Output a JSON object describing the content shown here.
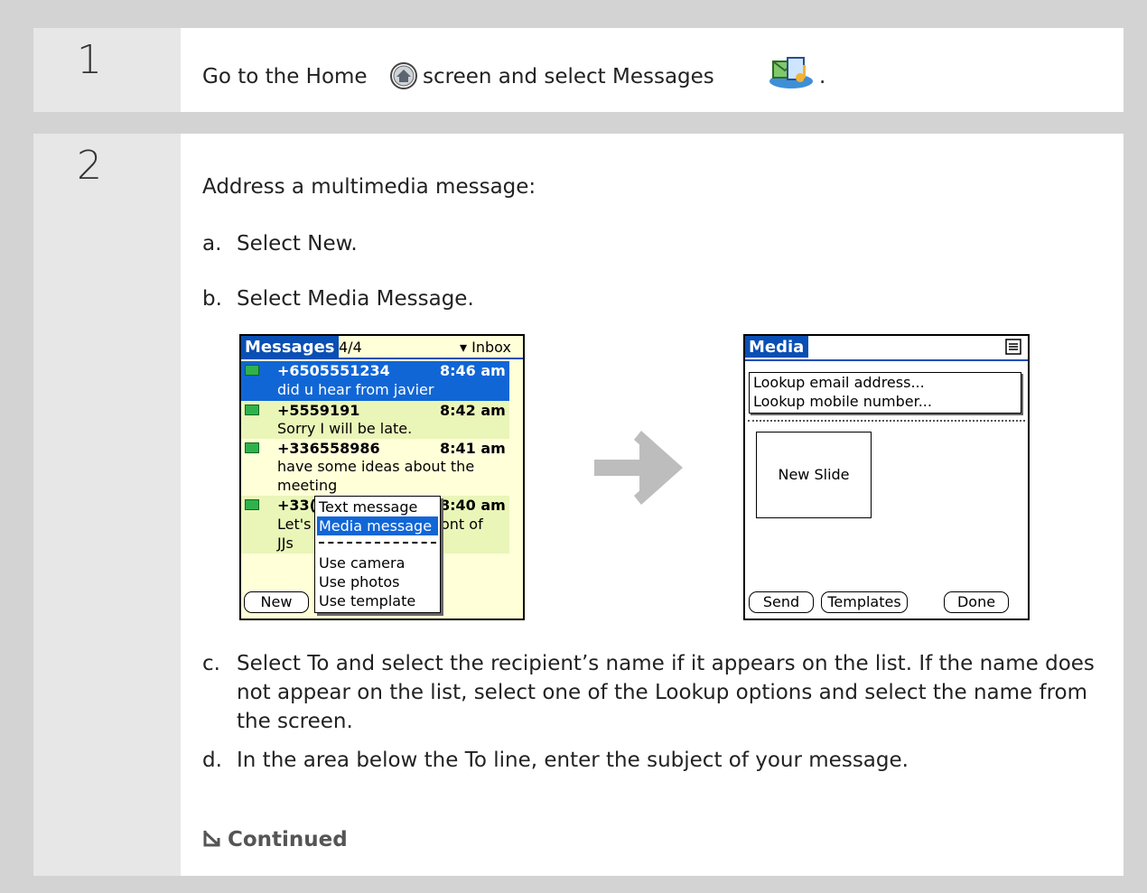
{
  "step1": {
    "number": "1",
    "text_before": "Go to the Home",
    "text_middle": "screen and select Messages",
    "text_end": ".",
    "home_icon": "home-icon",
    "messages_icon": "messages-icon"
  },
  "step2": {
    "number": "2",
    "intro": "Address a multimedia message:",
    "a_label": "a.",
    "a_text": "Select New.",
    "b_label": "b.",
    "b_text": "Select Media Message.",
    "c_label": "c.",
    "c_text": "Select To and select the recipient’s name if it appears on the list. If the name does not appear on the list, select one of the Lookup options and select the name from the screen.",
    "d_label": "d.",
    "d_text": "In the area below the To line, enter the subject of your message.",
    "continued": "Continued"
  },
  "screen1": {
    "title": "Messages",
    "count": "4/4",
    "folder": "Inbox",
    "messages": [
      {
        "from": "+6505551234",
        "time": "8:46 am",
        "preview": "did u hear from javier"
      },
      {
        "from": "+5559191",
        "time": "8:42 am",
        "preview": "Sorry I will be late."
      },
      {
        "from": "+336558986",
        "time": "8:41 am",
        "preview": "have some ideas about the",
        "preview2": "meeting"
      },
      {
        "from": "+33(",
        "time": "8:40 am",
        "preview": "Let's",
        "preview_tail": "ont of",
        "preview2": "JJs"
      }
    ],
    "menu": [
      "Text message",
      "Media message",
      "Use camera",
      "Use photos",
      "Use template"
    ],
    "new_button": "New"
  },
  "screen2": {
    "title": "Media",
    "lookup_items": [
      "Lookup email address...",
      "Lookup mobile number..."
    ],
    "slide_label": "New Slide",
    "send_button": "Send",
    "templates_button": "Templates",
    "done_button": "Done"
  },
  "colors": {
    "palm_blue": "#0a4fb4",
    "arrow_gray": "#bdbdbd"
  }
}
